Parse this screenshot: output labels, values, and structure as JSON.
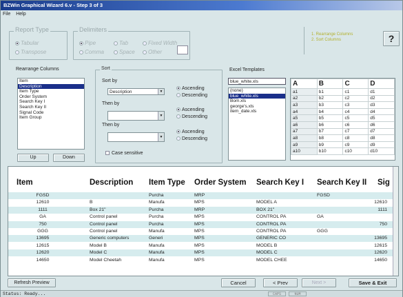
{
  "title": "BZWin Graphical Wizard 6.v - Step 3 of 3",
  "menu": [
    "File",
    "Help"
  ],
  "report_type": {
    "legend": "Report Type",
    "options": [
      "Tabular",
      "Transpose"
    ]
  },
  "delimiters": {
    "legend": "Delimiters",
    "row1": [
      "Pipe",
      "Tab",
      "Fixed Width"
    ],
    "row2": [
      "Comma",
      "Space",
      "Other"
    ]
  },
  "steps": {
    "step1": "1. Rearrange Columns",
    "step2": "2. Sort Columns",
    "help": "?"
  },
  "rearrange": {
    "legend": "Rearrange Columns",
    "items": [
      "Item",
      "Description",
      "Item Type",
      "Order System",
      "Search Key I",
      "Search Key II",
      "Signal Code",
      "Item Group"
    ],
    "selected": 1,
    "up": "Up",
    "down": "Down"
  },
  "sort": {
    "legend": "Sort",
    "sort_by": "Sort by",
    "sort_value": "Description",
    "then_by1": "Then by",
    "then_by2": "Then by",
    "ascending": "Ascending",
    "descending": "Descending",
    "case_sensitive": "Case sensitive"
  },
  "excel": {
    "legend": "Excel Templates",
    "input": "blue_white.xls",
    "files": [
      "(none)",
      "blue_white.xls",
      "Bom.xls",
      "george's.xls",
      "item_date.xls"
    ],
    "selected": 1,
    "cols": [
      "A",
      "B",
      "C",
      "D"
    ],
    "rows": [
      [
        "a1",
        "b1",
        "c1",
        "d1"
      ],
      [
        "a2",
        "b2",
        "c2",
        "d2"
      ],
      [
        "a3",
        "b3",
        "c3",
        "d3"
      ],
      [
        "a4",
        "b4",
        "c4",
        "d4"
      ],
      [
        "a5",
        "b5",
        "c5",
        "d5"
      ],
      [
        "a6",
        "b6",
        "c6",
        "d6"
      ],
      [
        "a7",
        "b7",
        "c7",
        "d7"
      ],
      [
        "a8",
        "b8",
        "c8",
        "d8"
      ],
      [
        "a9",
        "b9",
        "c9",
        "d9"
      ],
      [
        "a10",
        "b10",
        "c10",
        "d10"
      ]
    ]
  },
  "preview": {
    "headers": [
      "Item",
      "Description",
      "Item Type",
      "Order System",
      "Search Key I",
      "Search Key II",
      "Sig"
    ],
    "rows": [
      [
        "FGSD",
        "",
        "Purcha",
        "MRP",
        "",
        "FGSD",
        ""
      ],
      [
        "12610",
        "B",
        "Manufa",
        "MPS",
        "MODEL A",
        "",
        "12610"
      ],
      [
        "1111",
        "Box 21\"",
        "Purcha",
        "MRP",
        "BOX 21\"",
        "",
        "1111"
      ],
      [
        "GA",
        "Control panel",
        "Purcha",
        "MPS",
        "CONTROL PA",
        "GA",
        ""
      ],
      [
        "750",
        "Control panel",
        "Purcha",
        "MPS",
        "CONTROL PA",
        "",
        "750"
      ],
      [
        "GGG",
        "Control panel",
        "Manufa",
        "MPS",
        "CONTROL PA",
        "GGG",
        ""
      ],
      [
        "13695",
        "Generic computers",
        "Generi",
        "MPS",
        "GENERIC CO",
        "",
        "13695"
      ],
      [
        "12615",
        "Model B",
        "Manufa",
        "MPS",
        "MODEL B",
        "",
        "12615"
      ],
      [
        "12620",
        "Model C",
        "Manufa",
        "MPS",
        "MODEL C",
        "",
        "12620"
      ],
      [
        "14650",
        "Model Cheetah",
        "Manufa",
        "MPS",
        "MODEL CHEE",
        "",
        "14650"
      ]
    ]
  },
  "buttons": {
    "refresh": "Refresh Preview",
    "cancel": "Cancel",
    "prev": "< Prev",
    "next": "Next >",
    "save": "Save & Exit"
  },
  "status": {
    "text": "Status: Ready...",
    "caps": "CAPS",
    "num": "NUM"
  }
}
